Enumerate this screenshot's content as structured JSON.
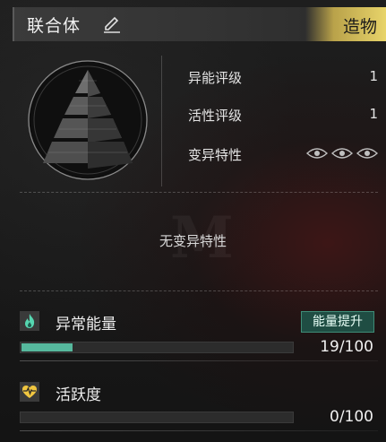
{
  "header": {
    "title": "联合体",
    "tag": "造物"
  },
  "stats": [
    {
      "label": "异能评级",
      "value": "1"
    },
    {
      "label": "活性评级",
      "value": "1"
    },
    {
      "label": "变异特性"
    }
  ],
  "traits": {
    "empty_text": "无变异特性"
  },
  "energy": {
    "title": "异常能量",
    "value_text": "19/100",
    "fraction": 0.19,
    "boost_label": "能量提升"
  },
  "vitality": {
    "title": "活跃度",
    "value_text": "0/100",
    "fraction": 0
  },
  "colors": {
    "accent_gold": "#e8d46a",
    "energy_green": "#56b89d",
    "vitality_yellow": "#f0c640"
  }
}
